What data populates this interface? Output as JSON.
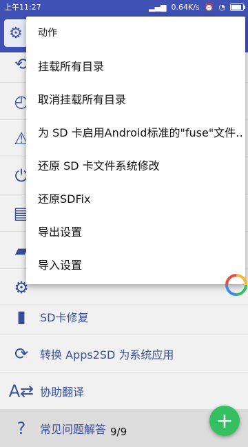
{
  "statusbar": {
    "time": "上午11:27",
    "network": "0.64K/s",
    "signal": "signal-icon",
    "battery_level": 0.8
  },
  "menu": {
    "header": "动作",
    "items": [
      "挂载所有目录",
      "取消挂载所有目录",
      "为 SD 卡启用Android标准的\"fuse\"文件‥",
      "还原 SD 卡文件系统修改",
      "还原SDFix",
      "导出设置",
      "导入设置"
    ]
  },
  "list": {
    "items": [
      {
        "label": "SD卡修复",
        "icon": "sd-card-icon"
      },
      {
        "label": "转换 Apps2SD 为系统应用",
        "icon": "android-convert-icon"
      },
      {
        "label": "协助翻译",
        "icon": "translate-icon"
      },
      {
        "label": "常见问题解答",
        "icon": "help-icon"
      }
    ]
  },
  "page_indicator": "9/9",
  "fab": {
    "label": "+"
  }
}
